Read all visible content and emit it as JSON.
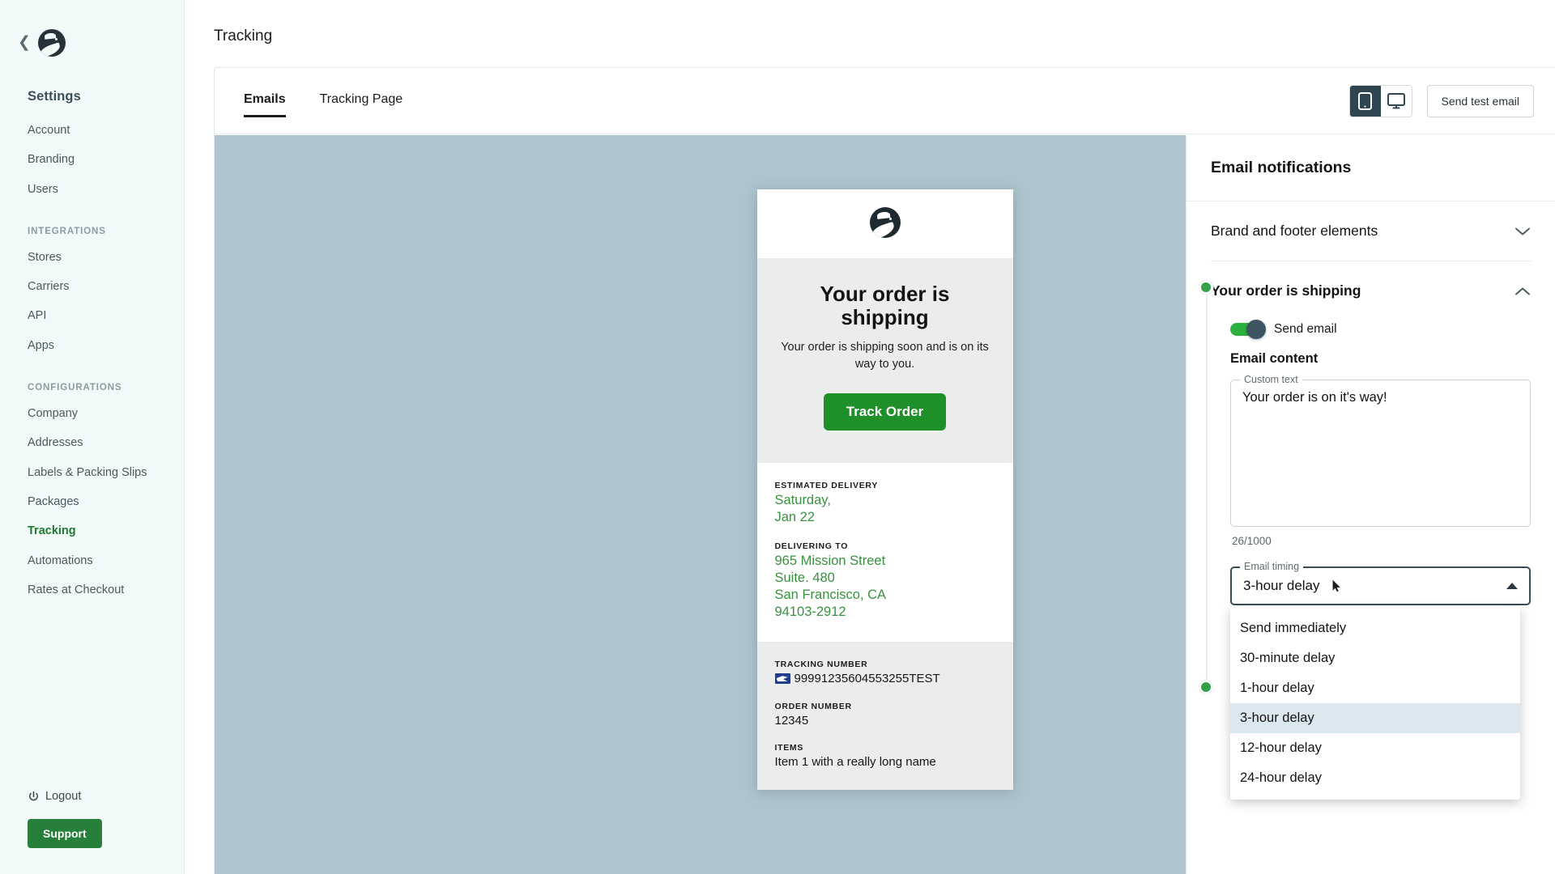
{
  "sidebar": {
    "collapse_icon": "chevron-left-icon",
    "logo_icon": "brand-logo-icon",
    "title": "Settings",
    "primary_items": [
      {
        "label": "Account",
        "active": false
      },
      {
        "label": "Branding",
        "active": false
      },
      {
        "label": "Users",
        "active": false
      }
    ],
    "groups": [
      {
        "label": "INTEGRATIONS",
        "items": [
          {
            "label": "Stores",
            "active": false
          },
          {
            "label": "Carriers",
            "active": false
          },
          {
            "label": "API",
            "active": false
          },
          {
            "label": "Apps",
            "active": false
          }
        ]
      },
      {
        "label": "CONFIGURATIONS",
        "items": [
          {
            "label": "Company",
            "active": false
          },
          {
            "label": "Addresses",
            "active": false
          },
          {
            "label": "Labels & Packing Slips",
            "active": false
          },
          {
            "label": "Packages",
            "active": false
          },
          {
            "label": "Tracking",
            "active": true
          },
          {
            "label": "Automations",
            "active": false
          },
          {
            "label": "Rates at Checkout",
            "active": false
          }
        ]
      }
    ],
    "logout_label": "Logout",
    "logout_icon": "power-icon",
    "support_label": "Support",
    "support_color": "#26803a",
    "active_color": "#1e7b2e"
  },
  "header": {
    "page_title": "Tracking"
  },
  "toolbar": {
    "tabs": [
      {
        "label": "Emails",
        "active": true
      },
      {
        "label": "Tracking Page",
        "active": false
      }
    ],
    "view_mobile_icon": "mobile-phone-icon",
    "view_desktop_icon": "desktop-monitor-icon",
    "active_view": "mobile",
    "send_test_label": "Send test email",
    "active_segment_color": "#2f4550"
  },
  "preview": {
    "background_color": "#aec5cf",
    "logo_icon": "brand-logo-icon",
    "heading": "Your order is shipping",
    "subtext": "Your order is shipping soon and is on its way to you.",
    "cta_label": "Track Order",
    "cta_color": "#1f8f2a",
    "accent_green": "#39913f",
    "estimated_delivery_label": "ESTIMATED DELIVERY",
    "estimated_delivery_line1": "Saturday,",
    "estimated_delivery_line2": "Jan 22",
    "delivering_to_label": "DELIVERING TO",
    "address_line1": "965 Mission Street",
    "address_line2": "Suite. 480",
    "address_line3": "San Francisco, CA",
    "address_line4": "94103-2912",
    "tracking_number_label": "TRACKING NUMBER",
    "carrier_icon": "usps-eagle-icon",
    "tracking_number": "99991235604553255TEST",
    "order_number_label": "ORDER NUMBER",
    "order_number": "12345",
    "items_label": "ITEMS",
    "item_1": "Item 1 with a really long name"
  },
  "panel": {
    "title": "Email notifications",
    "accordion_collapsed": {
      "label": "Brand and footer elements",
      "icon": "chevron-down-icon"
    },
    "accordion_expanded": {
      "label": "Your order is shipping",
      "icon": "chevron-up-icon",
      "status_dot_color": "#33a14a"
    },
    "toggle": {
      "label": "Send email",
      "on": true,
      "on_color": "#2bb03f"
    },
    "section_heading": "Email content",
    "custom_text": {
      "legend": "Custom text",
      "value": "Your order is on it's way!",
      "counter": "26/1000"
    },
    "email_timing": {
      "legend": "Email timing",
      "value": "3-hour delay",
      "caret_icon": "caret-up-icon",
      "options": [
        {
          "label": "Send immediately",
          "selected": false
        },
        {
          "label": "30-minute delay",
          "selected": false
        },
        {
          "label": "1-hour delay",
          "selected": false
        },
        {
          "label": "3-hour delay",
          "selected": true
        },
        {
          "label": "12-hour delay",
          "selected": false
        },
        {
          "label": "24-hour delay",
          "selected": false
        }
      ],
      "selected_highlight_color": "#dbe8ef"
    }
  }
}
